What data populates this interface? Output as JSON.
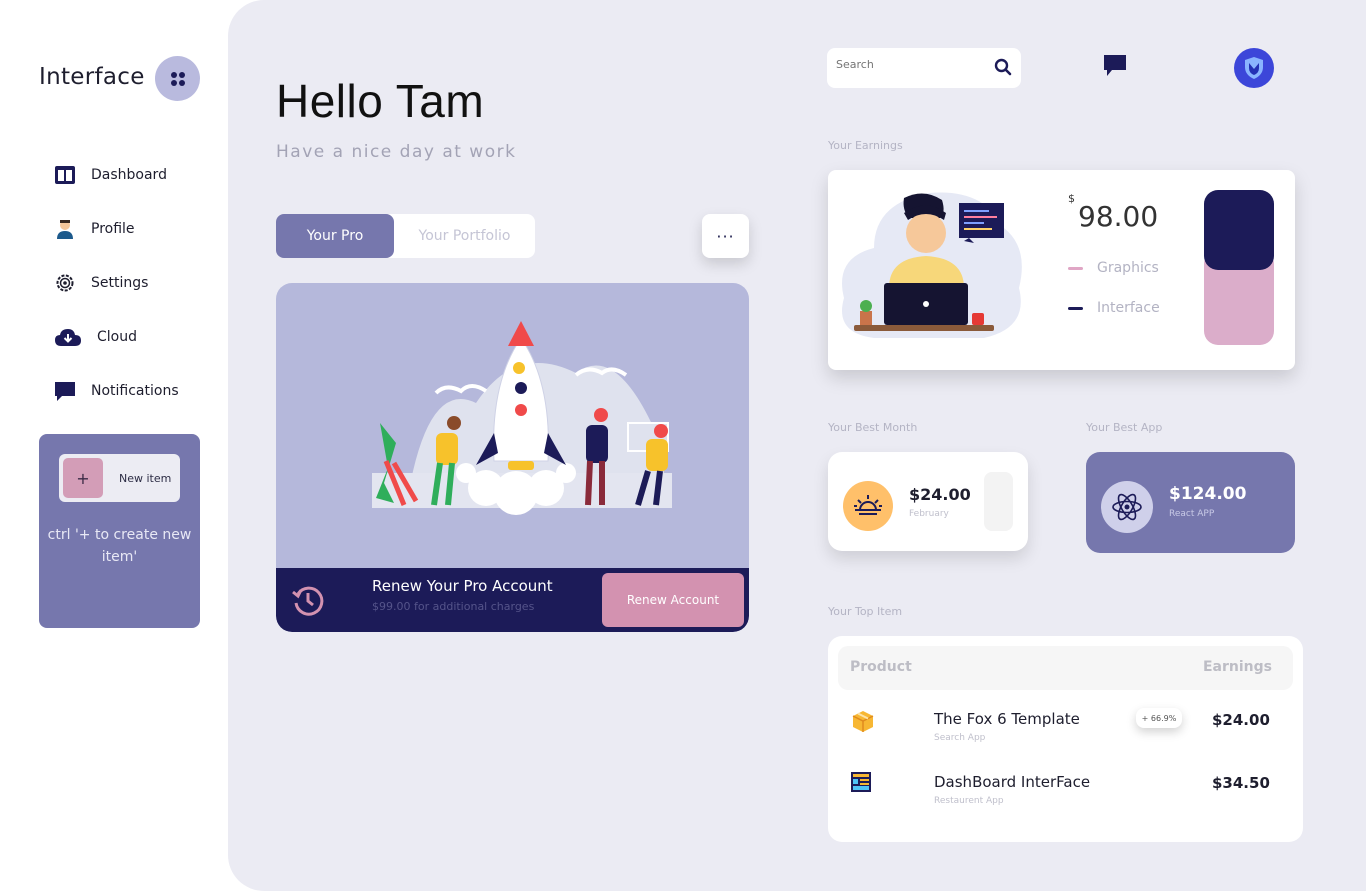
{
  "sidebar": {
    "brand": "Interface",
    "items": [
      {
        "label": "Dashboard",
        "icon": "dashboard-icon"
      },
      {
        "label": "Profile",
        "icon": "profile-icon"
      },
      {
        "label": "Settings",
        "icon": "gear-icon"
      },
      {
        "label": "Cloud",
        "icon": "cloud-download-icon"
      },
      {
        "label": "Notifications",
        "icon": "chat-icon"
      }
    ],
    "new_item": {
      "plus": "+",
      "label": "New item"
    },
    "hint": "ctrl '+ to create new item'"
  },
  "header": {
    "greeting": "Hello Tam",
    "subtitle": "Have a nice day at work"
  },
  "tabs": [
    {
      "label": "Your Pro",
      "active": true
    },
    {
      "label": "Your Portfolio",
      "active": false
    }
  ],
  "more_button": "···",
  "renew": {
    "title": "Renew Your Pro Account",
    "description": "$99.00 for additional charges",
    "button": "Renew Account"
  },
  "search": {
    "placeholder": "Search"
  },
  "earnings": {
    "section_label": "Your Earnings",
    "currency": "$",
    "amount": "98.00",
    "legend": [
      {
        "label": "Graphics",
        "color": "#e0a6c5"
      },
      {
        "label": "Interface",
        "color": "#1c1b58"
      }
    ]
  },
  "best_month": {
    "section_label": "Your Best Month",
    "value": "$24.00",
    "subtitle": "February"
  },
  "best_app": {
    "section_label": "Your Best App",
    "value": "$124.00",
    "subtitle": "React APP"
  },
  "top_items": {
    "section_label": "Your Top Item",
    "columns": [
      "Product",
      "Earnings"
    ],
    "rows": [
      {
        "name": "The Fox 6 Template",
        "category": "Search App",
        "earnings": "$24.00",
        "badge": "+ 66.9%",
        "icon": "package-box-icon"
      },
      {
        "name": "DashBoard InterFace",
        "category": "Restaurent App",
        "earnings": "$34.50",
        "badge": "",
        "icon": "dashboard-window-icon"
      }
    ]
  },
  "colors": {
    "accent": "#7677ad",
    "navy": "#1c1b58",
    "pink": "#d392b0",
    "background": "#ebebf3"
  }
}
